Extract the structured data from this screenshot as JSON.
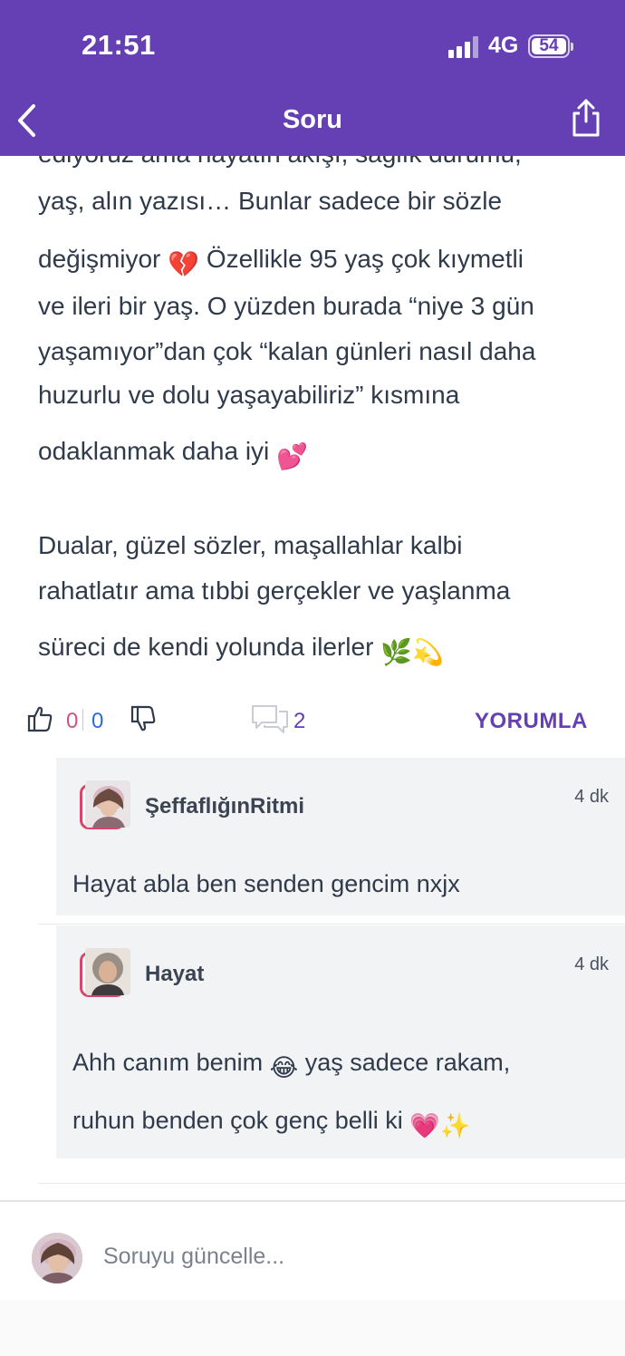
{
  "status_bar": {
    "time": "21:51",
    "network": "4G",
    "battery": "54"
  },
  "header": {
    "title": "Soru",
    "back_icon": "chevron-left-icon",
    "share_icon": "share-icon"
  },
  "answer": {
    "lines": [
      "ediyoruz ama hayatın akışı, sağlık durumu,",
      "yaş, alın yazısı… Bunlar sadece bir sözle",
      "değişmiyor",
      "Özellikle 95 yaş çok kıymetli",
      "ve ileri bir yaş. O yüzden burada “niye 3 gün",
      "yaşamıyor”dan çok “kalan günleri nasıl daha",
      "huzurlu ve dolu yaşayabiliriz” kısmına",
      "odaklanmak daha iyi",
      "Dualar, güzel sözler, maşallahlar kalbi",
      "rahatlatır ama tıbbi gerçekler ve yaşlanma",
      "süreci de kendi yolunda ilerler"
    ],
    "emojis": {
      "broken_heart": "💔",
      "two_hearts": "💕",
      "herb": "🌿",
      "dizzy": "💫"
    }
  },
  "actions": {
    "like_count": "0",
    "dislike_count": "0",
    "comment_count": "2",
    "reply_label": "YORUMLA"
  },
  "comments": [
    {
      "author": "ŞeffaflığınRitmi",
      "time": "4 dk",
      "text": "Hayat abla ben senden gencim nxjx"
    },
    {
      "author": "Hayat",
      "time": "4 dk",
      "text_line1": "Ahh canım benim",
      "text_line1_rest": "yaş sadece rakam,",
      "text_line2": "ruhun benden çok genç belli ki",
      "emoji_laugh": "😂",
      "emoji_heart": "💗",
      "emoji_sparkles": "✨"
    }
  ],
  "composer": {
    "placeholder": "Soruyu güncelle..."
  },
  "colors": {
    "brand": "#6440b4",
    "like": "#d05283",
    "dislike": "#2e6bd6"
  }
}
